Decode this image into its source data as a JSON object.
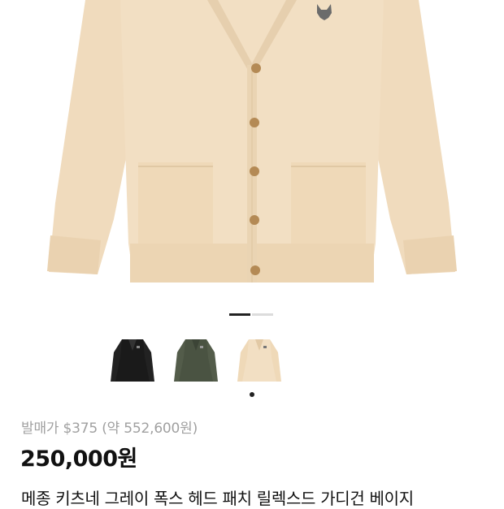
{
  "product": {
    "original_price": "발매가 $375 (약 552,600원)",
    "price": "250,000원",
    "title": "메종 키츠네 그레이 폭스 헤드 패치 릴렉스드 가디건 베이지"
  },
  "gallery": {
    "active_index": 0,
    "slide_count": 2,
    "colors": {
      "beige": "#f2dfc3",
      "beige_shadow": "#e6cfae",
      "button": "#b48a55",
      "black": "#1a1a1a",
      "khaki": "#4a5342"
    }
  },
  "variants": [
    {
      "name": "black"
    },
    {
      "name": "khaki"
    },
    {
      "name": "beige",
      "selected": true
    }
  ]
}
